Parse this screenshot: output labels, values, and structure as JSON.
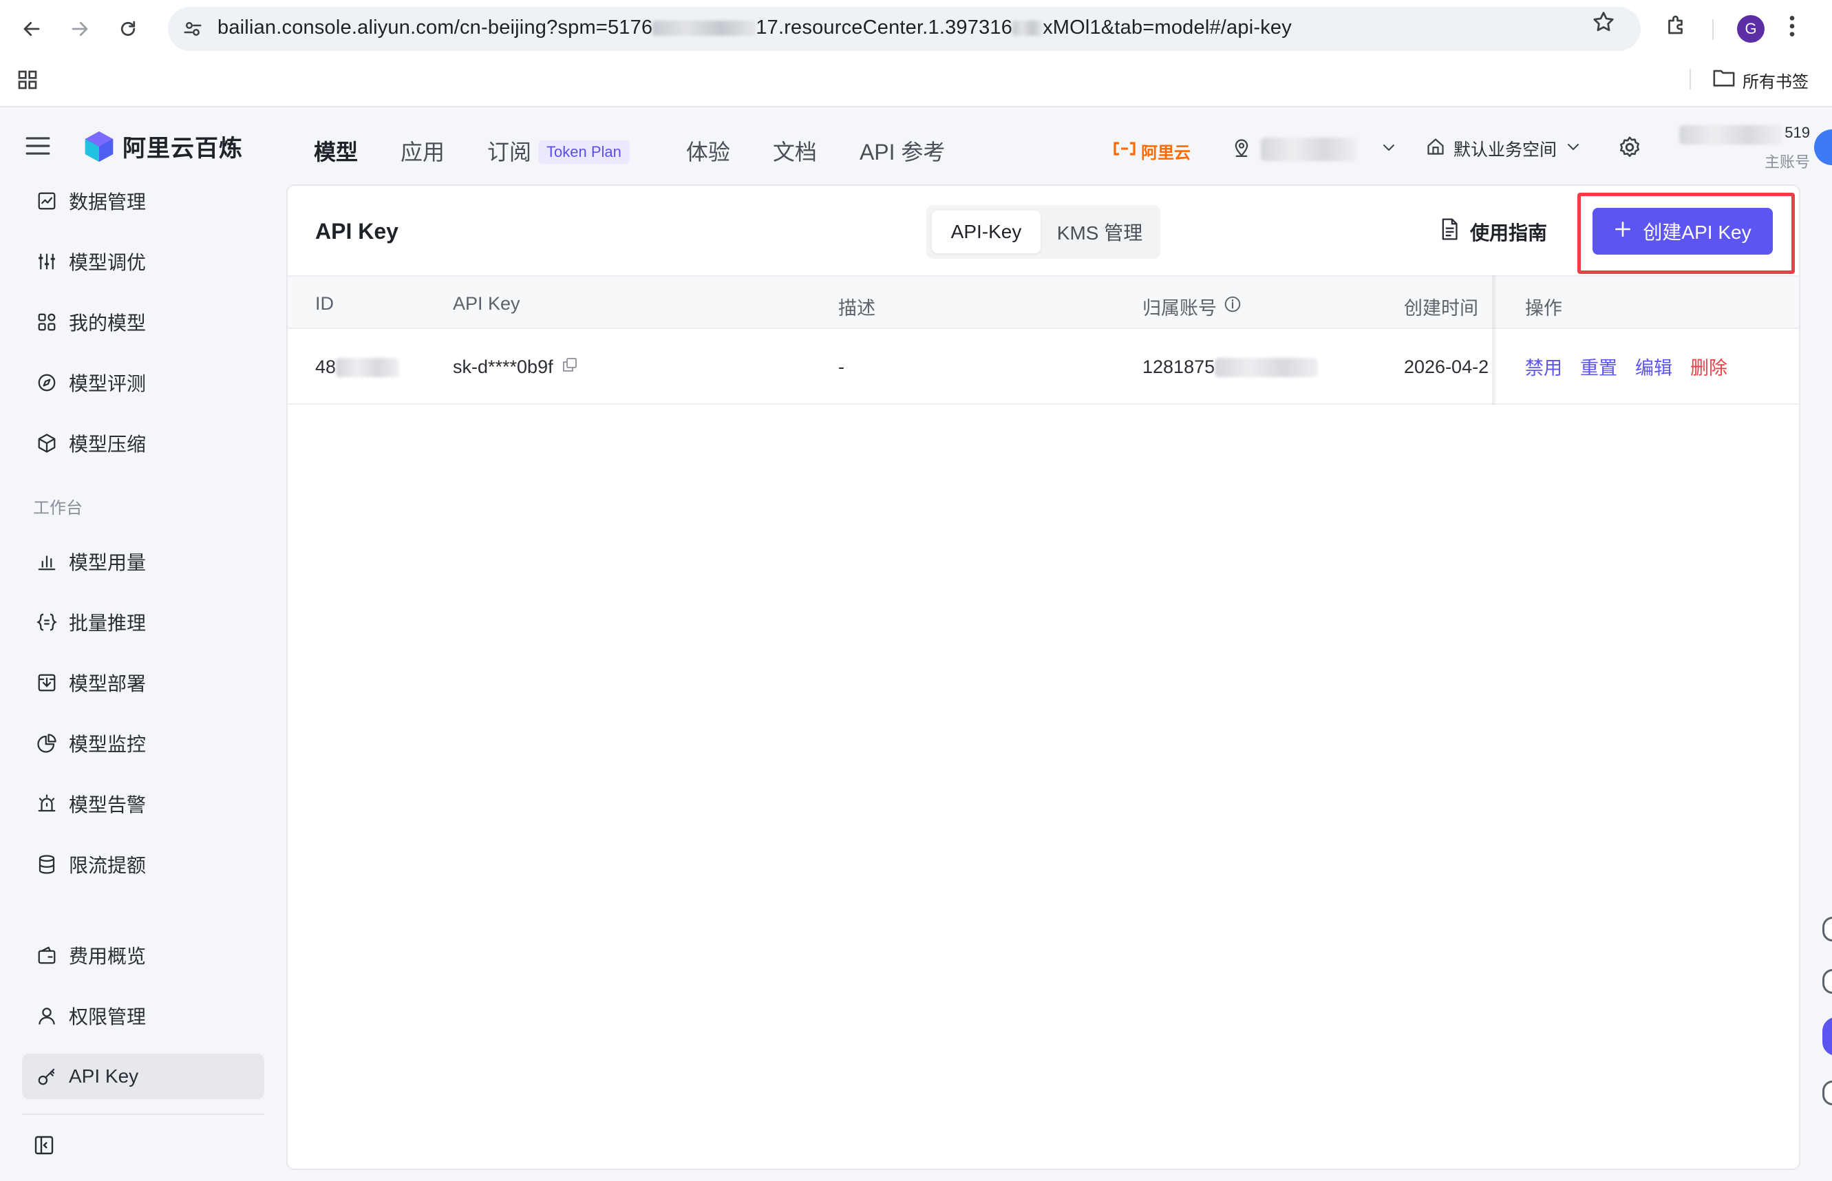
{
  "browser": {
    "url_prefix": "bailian.console.aliyun.com/cn-beijing?spm=5176",
    "url_mid": "17.resourceCenter.1.397316",
    "url_suffix": "xMOl1&tab=model#/api-key",
    "profile_initial": "G",
    "bookmarks_folder": "所有书签"
  },
  "app": {
    "logo_text": "阿里云百炼",
    "nav": [
      {
        "label": "模型"
      },
      {
        "label": "应用"
      },
      {
        "label": "订阅",
        "tag": "Token Plan"
      },
      {
        "label": "体验"
      },
      {
        "label": "文档"
      },
      {
        "label": "API 参考"
      }
    ],
    "aliyun_brand": "阿里云",
    "workspace": "默认业务空间",
    "account_suffix": "519",
    "account_role": "主账号"
  },
  "sidebar": {
    "items_top": [
      {
        "label": "数据管理",
        "icon": "chart-line-icon"
      },
      {
        "label": "模型调优",
        "icon": "sliders-icon"
      },
      {
        "label": "我的模型",
        "icon": "grid-icon"
      },
      {
        "label": "模型评测",
        "icon": "compass-icon"
      },
      {
        "label": "模型压缩",
        "icon": "cube-icon"
      }
    ],
    "group_label": "工作台",
    "items_work": [
      {
        "label": "模型用量",
        "icon": "bar-chart-icon"
      },
      {
        "label": "批量推理",
        "icon": "braces-icon"
      },
      {
        "label": "模型部署",
        "icon": "deploy-icon"
      },
      {
        "label": "模型监控",
        "icon": "pie-icon"
      },
      {
        "label": "模型告警",
        "icon": "alarm-icon"
      },
      {
        "label": "限流提额",
        "icon": "database-icon"
      }
    ],
    "items_bottom": [
      {
        "label": "费用概览",
        "icon": "wallet-icon"
      },
      {
        "label": "权限管理",
        "icon": "user-icon"
      },
      {
        "label": "API Key",
        "icon": "key-icon",
        "active": true
      }
    ]
  },
  "panel": {
    "title": "API Key",
    "segments": [
      "API-Key",
      "KMS 管理"
    ],
    "guide_label": "使用指南",
    "create_label": "创建API Key",
    "columns": [
      "ID",
      "API Key",
      "描述",
      "归属账号",
      "创建时间",
      "操作"
    ],
    "rows": [
      {
        "id": "48",
        "api_key": "sk-d****0b9f",
        "description": "-",
        "account": "1281875",
        "created": "2026-04-2",
        "actions": [
          "禁用",
          "重置",
          "编辑",
          "删除"
        ]
      }
    ]
  },
  "colors": {
    "primary": "#5d55ef",
    "danger": "#ef3e46",
    "brand_orange": "#ff6a00",
    "highlight_outline": "#ef3e46"
  }
}
